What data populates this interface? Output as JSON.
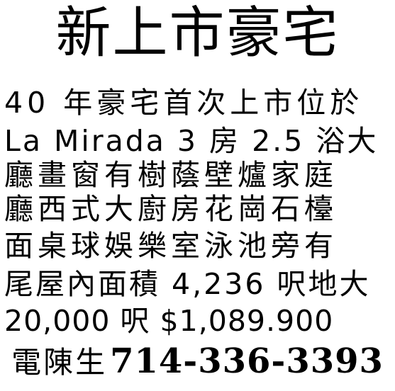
{
  "ad": {
    "headline": "新上市豪宅",
    "lines": [
      "40 年豪宅首次上市位於",
      "La Mirada 3 房 2.5 浴大",
      "廳畫窗有樹蔭壁爐家庭",
      "廳西式大廚房花崗石檯",
      "面桌球娛樂室泳池旁有",
      "尾屋內面積 4,236 呎地大",
      "20,000 呎 $1,089.900"
    ],
    "contact_label": "電陳生",
    "phone": "714-336-3393"
  }
}
